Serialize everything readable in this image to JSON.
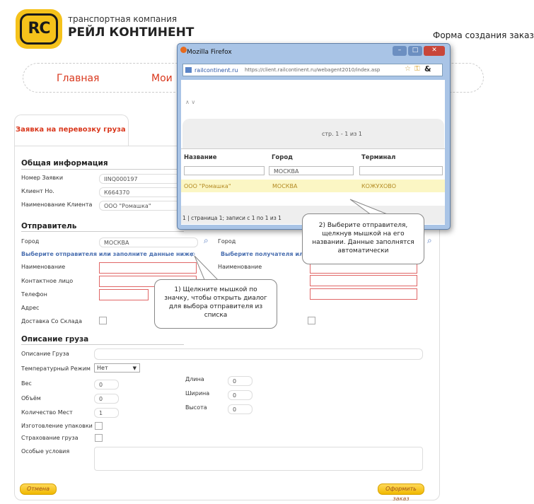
{
  "header": {
    "logo_text": "RC",
    "company_subtitle": "транспортная компания",
    "company_name": "РЕЙЛ КОНТИНЕНТ",
    "form_title": "Форма создания заказа"
  },
  "nav": {
    "items": [
      "Главная",
      "Мои"
    ]
  },
  "tab": {
    "label": "Заявка на перевозку груза"
  },
  "general": {
    "title": "Общая информация",
    "fields": [
      {
        "label": "Номер Заявки",
        "value": "IINQ000197"
      },
      {
        "label": "Клиент Но.",
        "value": "К664370"
      },
      {
        "label": "Наименование Клиента",
        "value": "ООО \"Ромашка\""
      }
    ]
  },
  "sender": {
    "title": "Отправитель",
    "city_label": "Город",
    "city_value": "МОСКВА",
    "city2_label": "Город",
    "choose_sender_hint": "Выберите отправителя или заполните данные ниже",
    "choose_receiver_hint": "Выберите получателя или",
    "name_label": "Наименование",
    "name2_label": "Наименование",
    "contact_label": "Контактное лицо",
    "phone_label": "Телефон",
    "address_label": "Адрес",
    "warehouse_label": "Доставка Со Склада"
  },
  "cargo": {
    "title": "Описание груза",
    "desc_label": "Описание Груза",
    "temp_label": "Температурный Режим",
    "temp_value": "Нет",
    "weight_label": "Вес",
    "weight_value": "0",
    "volume_label": "Объём",
    "volume_value": "0",
    "places_label": "Количество Мест",
    "places_value": "1",
    "length_label": "Длина",
    "length_value": "0",
    "width_label": "Ширина",
    "width_value": "0",
    "height_label": "Высота",
    "height_value": "0",
    "packaging_label": "Изготовление упаковки",
    "insurance_label": "Страхование груза",
    "special_label": "Особые условия"
  },
  "buttons": {
    "cancel": "Отмена",
    "submit": "Оформить заказ"
  },
  "popup": {
    "window_title": "Mozilla Firefox",
    "url_domain": "railcontinent.ru",
    "url_full": "https://client.railcontinent.ru/webagent2010/index.asp",
    "nav_arrows": "∧ ∨",
    "pager_text": "стр. 1 - 1 из 1",
    "col_name": "Название",
    "col_city": "Город",
    "col_terminal": "Терминал",
    "filter_city": "МОСКВА",
    "row_name": "ООО \"Ромашка\"",
    "row_city": "МОСКВА",
    "row_terminal": "КОЖУХОВО",
    "footer_text": "1 | страница 1; записи с 1 по 1 из 1"
  },
  "callouts": {
    "one": "1) Щелкните мышкой по значку, чтобы открыть диалог для выбора отправителя из списка",
    "two": "2) Выберите отправителя, щелкнув мышкой на его названии. Данные заполнятся автоматически"
  },
  "colors": {
    "accent": "#d9371c",
    "logo_yellow": "#f5c21b",
    "button_yellow": "#f0b800",
    "highlight_row": "#fbf6c4",
    "error_border": "#e06666"
  }
}
